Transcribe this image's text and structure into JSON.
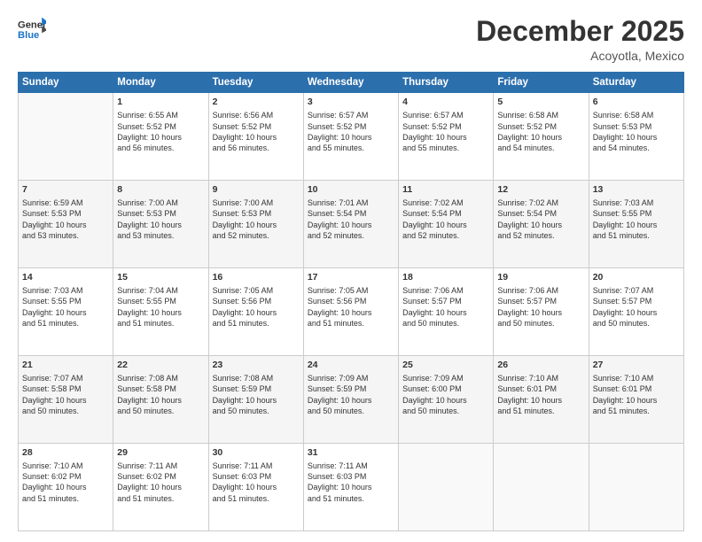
{
  "header": {
    "logo_line1": "General",
    "logo_line2": "Blue",
    "month": "December 2025",
    "location": "Acoyotla, Mexico"
  },
  "days_of_week": [
    "Sunday",
    "Monday",
    "Tuesday",
    "Wednesday",
    "Thursday",
    "Friday",
    "Saturday"
  ],
  "weeks": [
    [
      {
        "day": "",
        "info": ""
      },
      {
        "day": "1",
        "info": "Sunrise: 6:55 AM\nSunset: 5:52 PM\nDaylight: 10 hours\nand 56 minutes."
      },
      {
        "day": "2",
        "info": "Sunrise: 6:56 AM\nSunset: 5:52 PM\nDaylight: 10 hours\nand 56 minutes."
      },
      {
        "day": "3",
        "info": "Sunrise: 6:57 AM\nSunset: 5:52 PM\nDaylight: 10 hours\nand 55 minutes."
      },
      {
        "day": "4",
        "info": "Sunrise: 6:57 AM\nSunset: 5:52 PM\nDaylight: 10 hours\nand 55 minutes."
      },
      {
        "day": "5",
        "info": "Sunrise: 6:58 AM\nSunset: 5:52 PM\nDaylight: 10 hours\nand 54 minutes."
      },
      {
        "day": "6",
        "info": "Sunrise: 6:58 AM\nSunset: 5:53 PM\nDaylight: 10 hours\nand 54 minutes."
      }
    ],
    [
      {
        "day": "7",
        "info": "Sunrise: 6:59 AM\nSunset: 5:53 PM\nDaylight: 10 hours\nand 53 minutes."
      },
      {
        "day": "8",
        "info": "Sunrise: 7:00 AM\nSunset: 5:53 PM\nDaylight: 10 hours\nand 53 minutes."
      },
      {
        "day": "9",
        "info": "Sunrise: 7:00 AM\nSunset: 5:53 PM\nDaylight: 10 hours\nand 52 minutes."
      },
      {
        "day": "10",
        "info": "Sunrise: 7:01 AM\nSunset: 5:54 PM\nDaylight: 10 hours\nand 52 minutes."
      },
      {
        "day": "11",
        "info": "Sunrise: 7:02 AM\nSunset: 5:54 PM\nDaylight: 10 hours\nand 52 minutes."
      },
      {
        "day": "12",
        "info": "Sunrise: 7:02 AM\nSunset: 5:54 PM\nDaylight: 10 hours\nand 52 minutes."
      },
      {
        "day": "13",
        "info": "Sunrise: 7:03 AM\nSunset: 5:55 PM\nDaylight: 10 hours\nand 51 minutes."
      }
    ],
    [
      {
        "day": "14",
        "info": "Sunrise: 7:03 AM\nSunset: 5:55 PM\nDaylight: 10 hours\nand 51 minutes."
      },
      {
        "day": "15",
        "info": "Sunrise: 7:04 AM\nSunset: 5:55 PM\nDaylight: 10 hours\nand 51 minutes."
      },
      {
        "day": "16",
        "info": "Sunrise: 7:05 AM\nSunset: 5:56 PM\nDaylight: 10 hours\nand 51 minutes."
      },
      {
        "day": "17",
        "info": "Sunrise: 7:05 AM\nSunset: 5:56 PM\nDaylight: 10 hours\nand 51 minutes."
      },
      {
        "day": "18",
        "info": "Sunrise: 7:06 AM\nSunset: 5:57 PM\nDaylight: 10 hours\nand 50 minutes."
      },
      {
        "day": "19",
        "info": "Sunrise: 7:06 AM\nSunset: 5:57 PM\nDaylight: 10 hours\nand 50 minutes."
      },
      {
        "day": "20",
        "info": "Sunrise: 7:07 AM\nSunset: 5:57 PM\nDaylight: 10 hours\nand 50 minutes."
      }
    ],
    [
      {
        "day": "21",
        "info": "Sunrise: 7:07 AM\nSunset: 5:58 PM\nDaylight: 10 hours\nand 50 minutes."
      },
      {
        "day": "22",
        "info": "Sunrise: 7:08 AM\nSunset: 5:58 PM\nDaylight: 10 hours\nand 50 minutes."
      },
      {
        "day": "23",
        "info": "Sunrise: 7:08 AM\nSunset: 5:59 PM\nDaylight: 10 hours\nand 50 minutes."
      },
      {
        "day": "24",
        "info": "Sunrise: 7:09 AM\nSunset: 5:59 PM\nDaylight: 10 hours\nand 50 minutes."
      },
      {
        "day": "25",
        "info": "Sunrise: 7:09 AM\nSunset: 6:00 PM\nDaylight: 10 hours\nand 50 minutes."
      },
      {
        "day": "26",
        "info": "Sunrise: 7:10 AM\nSunset: 6:01 PM\nDaylight: 10 hours\nand 51 minutes."
      },
      {
        "day": "27",
        "info": "Sunrise: 7:10 AM\nSunset: 6:01 PM\nDaylight: 10 hours\nand 51 minutes."
      }
    ],
    [
      {
        "day": "28",
        "info": "Sunrise: 7:10 AM\nSunset: 6:02 PM\nDaylight: 10 hours\nand 51 minutes."
      },
      {
        "day": "29",
        "info": "Sunrise: 7:11 AM\nSunset: 6:02 PM\nDaylight: 10 hours\nand 51 minutes."
      },
      {
        "day": "30",
        "info": "Sunrise: 7:11 AM\nSunset: 6:03 PM\nDaylight: 10 hours\nand 51 minutes."
      },
      {
        "day": "31",
        "info": "Sunrise: 7:11 AM\nSunset: 6:03 PM\nDaylight: 10 hours\nand 51 minutes."
      },
      {
        "day": "",
        "info": ""
      },
      {
        "day": "",
        "info": ""
      },
      {
        "day": "",
        "info": ""
      }
    ]
  ]
}
